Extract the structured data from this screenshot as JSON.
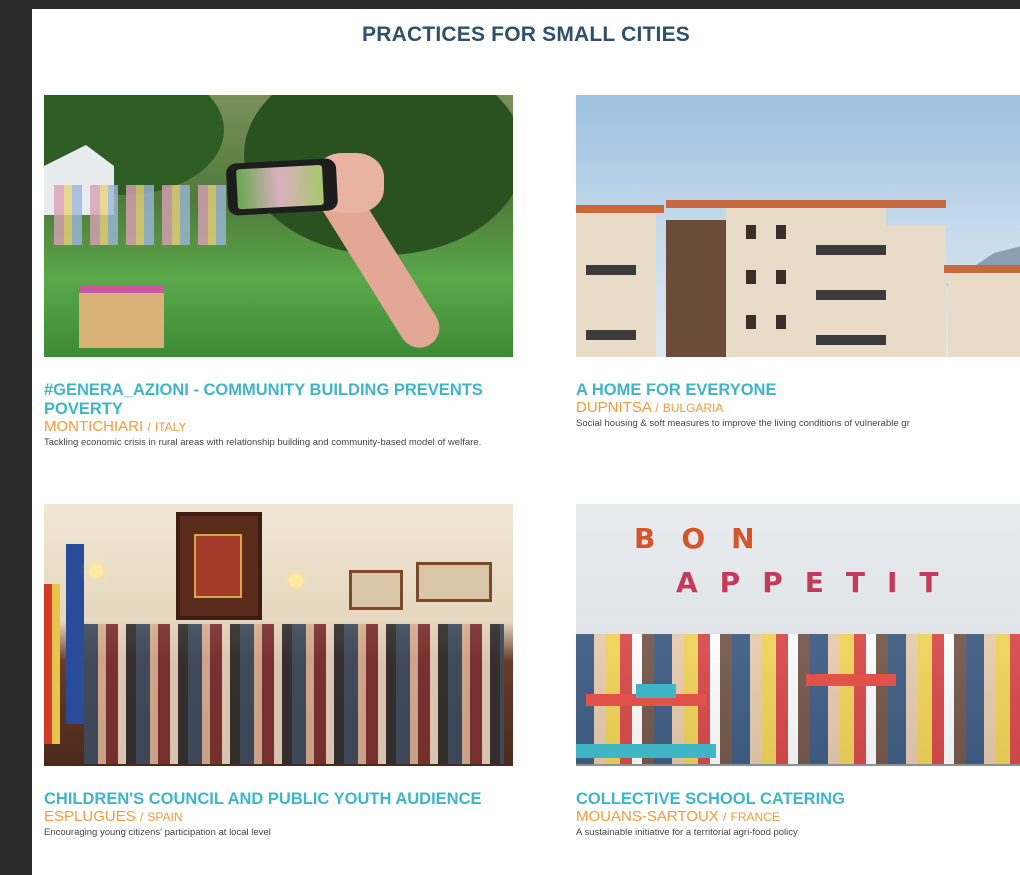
{
  "page": {
    "title": "PRACTICES FOR SMALL CITIES"
  },
  "cards": [
    {
      "title": "#GENERA_AZIONI - COMMUNITY BUILDING PREVENTS POVERTY",
      "city": "MONTICHIARI",
      "country": "ITALY",
      "description": "Tackling economic crisis in rural areas with relationship building and community-based model of welfare."
    },
    {
      "title": "A HOME FOR EVERYONE",
      "city": "DUPNITSA",
      "country": "BULGARIA",
      "description": "Social housing & soft measures to improve the living conditions of vulnerable gr"
    },
    {
      "title": "CHILDREN'S COUNCIL AND PUBLIC YOUTH AUDIENCE",
      "city": "ESPLUGUES",
      "country": "SPAIN",
      "description": "Encouraging young citizens' participation at local level"
    },
    {
      "title": "COLLECTIVE SCHOOL CATERING",
      "city": "MOUANS-SARTOUX",
      "country": "FRANCE",
      "description": "A sustainable initiative for a territorial agri-food policy"
    }
  ],
  "canteen_wall": {
    "line1": "BON",
    "line2": "APPETIT"
  },
  "colors": {
    "title": "#2f4f6a",
    "card_title": "#3fb5c6",
    "location": "#f29a3c",
    "frame": "#2b2b2b"
  }
}
